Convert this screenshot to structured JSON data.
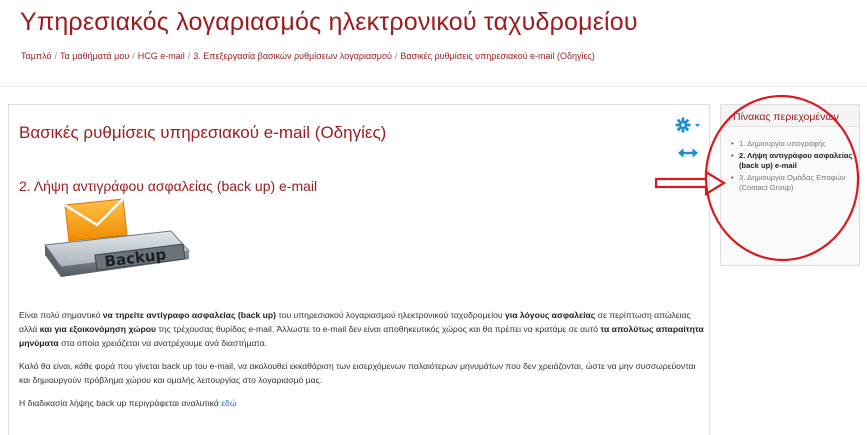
{
  "site": {
    "title": "Υπηρεσιακός λογαριασμός ηλεκτρονικού ταχυδρομείου"
  },
  "breadcrumb": [
    "Ταμπλό",
    "Τα μαθήματά μου",
    "HCG e-mail",
    "3. Επεξεργασία βασικών ρυθμίσεων λογαριασμού",
    "Βασικές ρυθμίσεις υπηρεσιακού e-mail (Οδηγίες)"
  ],
  "main": {
    "title": "Βασικές ρυθμίσεις υπηρεσιακού e-mail (Οδηγίες)",
    "section_heading": "2. Λήψη αντιγράφου ασφαλείας (back up) e-mail",
    "image_label": "Backup",
    "paragraph1": {
      "t1": "Είναι πολύ σημαντικό ",
      "b1": "να τηρείτε αντίγραφο ασφαλείας (back up)",
      "t2": " του υπηρεσιακού λογαριασμού ηλεκτρονικού ταχυδρομείου ",
      "b2": "για λόγους ασφαλείας",
      "t3": " σε περίπτωση απώλειας αλλά ",
      "b3": "και για εξοικονόμηση χώρου",
      "t4": " της τρέχουσας θυρίδας e-mail. Άλλωστε το e-mail δεν είναι αποθηκευτικός χώρος και θα πρέπει να κρατάμε σε αυτό ",
      "b4": "τα απολύτως απαραίτητα μηνύματα",
      "t5": " στα οποία χρειάζεται να ανατρέχουμε ανά διαστήματα."
    },
    "paragraph2": "Καλό θα είναι, κάθε φορά που γίνεται back up του e-mail, να ακολουθεί εκκαθάριση των εισερχόμενων παλαιότερων μηνυμάτων που δεν χρειάζονται, ώστε να μην συσσωρεύονται και δημιουργούν πρόβλημα χώρου και ομαλής λειτουργίας στο λογαριασμό μας.",
    "paragraph3_text": "Η διαδικασία λήψης back up περιγράφεται αναλυτικά ",
    "paragraph3_link": "εδώ"
  },
  "toc": {
    "title": "Πίνακας περιεχομένων",
    "items": [
      {
        "label": "1. Δημιουργία υπογραφής",
        "active": false
      },
      {
        "label": "2. Λήψη αντιγράφου ασφαλείας (back up) e-mail",
        "active": true
      },
      {
        "label": "3. Δημιουργία Ομάδας Επαφών (Contact Group)",
        "active": false
      }
    ]
  },
  "icons": {
    "gear": "gear-icon",
    "caret": "caret-down-icon",
    "expand": "expand-arrows-icon"
  },
  "colors": {
    "brand": "#9b1b1f",
    "link": "#2a6fbe",
    "accent_blue": "#1a8fd6",
    "annotation": "#d71920"
  }
}
